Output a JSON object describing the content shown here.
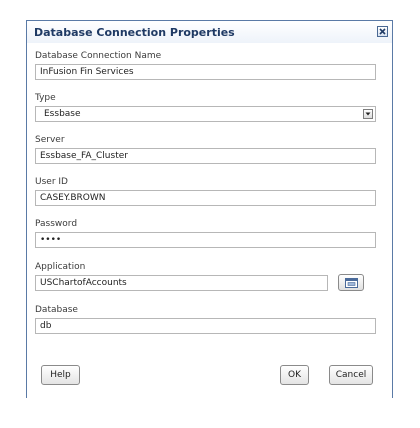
{
  "dialog": {
    "title": "Database Connection Properties",
    "fields": {
      "connection_name": {
        "label": "Database Connection Name",
        "value": "InFusion Fin Services"
      },
      "type": {
        "label": "Type",
        "value": "Essbase"
      },
      "server": {
        "label": "Server",
        "value": "Essbase_FA_Cluster"
      },
      "user_id": {
        "label": "User ID",
        "value": "CASEY.BROWN"
      },
      "password": {
        "label": "Password",
        "value": "••••"
      },
      "application": {
        "label": "Application",
        "value": "USChartofAccounts"
      },
      "database": {
        "label": "Database",
        "value": "db"
      }
    },
    "buttons": {
      "help": "Help",
      "ok": "OK",
      "cancel": "Cancel"
    },
    "icons": {
      "close": "close-icon",
      "dropdown": "chevron-down-icon",
      "browse": "browse-icon"
    },
    "colors": {
      "title_text": "#1f3a64",
      "border": "#5a7aa6"
    }
  }
}
